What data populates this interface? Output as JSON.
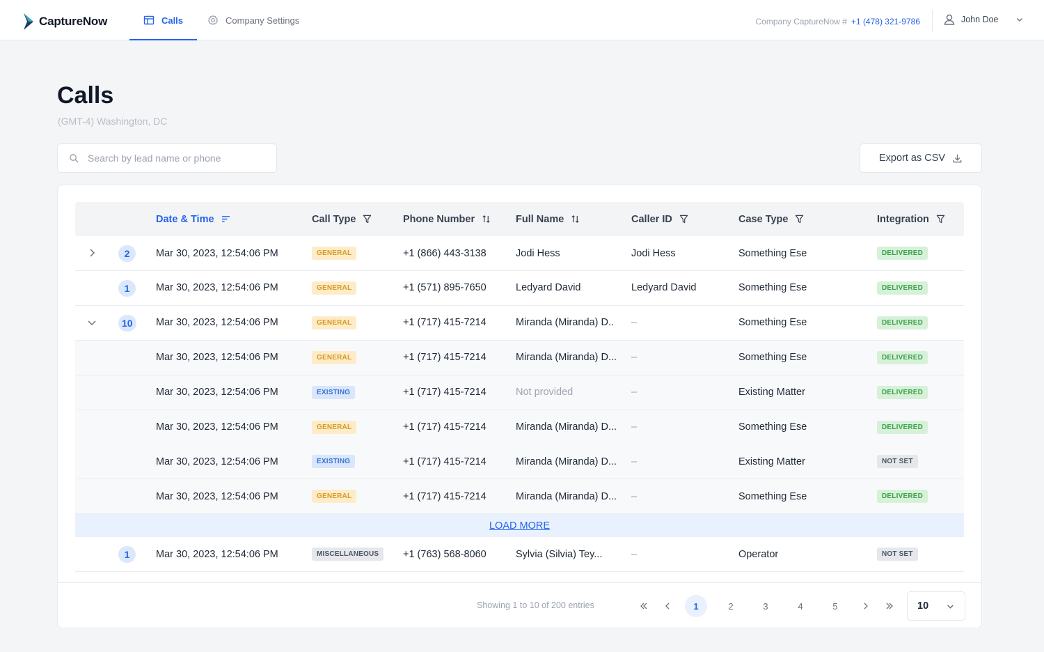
{
  "nav": {
    "brand": "CaptureNow",
    "tabs": [
      {
        "label": "Calls",
        "icon": "table-icon",
        "active": true
      },
      {
        "label": "Company Settings",
        "icon": "gear-icon",
        "active": false
      }
    ],
    "company_label": "Company CaptureNow #",
    "company_phone": "+1 (478) 321-9786",
    "user_name": "John Doe"
  },
  "header": {
    "title": "Calls",
    "timezone": "(GMT-4) Washington, DC",
    "search_placeholder": "Search by lead name or phone",
    "export_label": "Export as CSV"
  },
  "table": {
    "columns": [
      "Date & Time",
      "Call Type",
      "Phone Number",
      "Full Name",
      "Caller ID",
      "Case Type",
      "Integration"
    ],
    "rows": [
      {
        "expander": "collapsed",
        "count": "2",
        "datetime": "Mar 30, 2023, 12:54:06 PM",
        "call_type": "GENERAL",
        "phone": "+1 (866) 443-3138",
        "name": "Jodi Hess",
        "caller_id": "Jodi Hess",
        "case_type": "Something Ese",
        "integration": "DELIVERED"
      },
      {
        "expander": "none",
        "count": "1",
        "datetime": "Mar 30, 2023, 12:54:06 PM",
        "call_type": "GENERAL",
        "phone": "+1 (571) 895-7650",
        "name": "Ledyard David",
        "caller_id": "Ledyard David",
        "case_type": "Something Ese",
        "integration": "DELIVERED"
      },
      {
        "expander": "expanded",
        "count": "10",
        "datetime": "Mar 30, 2023, 12:54:06 PM",
        "call_type": "GENERAL",
        "phone": "+1 (717) 415-7214",
        "name": "Miranda (Miranda) D..",
        "caller_id": "–",
        "case_type": "Something Ese",
        "integration": "DELIVERED"
      },
      {
        "child": true,
        "datetime": "Mar 30, 2023, 12:54:06 PM",
        "call_type": "GENERAL",
        "phone": "+1 (717) 415-7214",
        "name": "Miranda (Miranda) D...",
        "caller_id": "–",
        "case_type": "Something Ese",
        "integration": "DELIVERED"
      },
      {
        "child": true,
        "datetime": "Mar 30, 2023, 12:54:06 PM",
        "call_type": "EXISTING",
        "phone": "+1 (717) 415-7214",
        "name": "Not provided",
        "name_muted": true,
        "caller_id": "–",
        "case_type": "Existing Matter",
        "integration": "DELIVERED"
      },
      {
        "child": true,
        "datetime": "Mar 30, 2023, 12:54:06 PM",
        "call_type": "GENERAL",
        "phone": "+1 (717) 415-7214",
        "name": "Miranda (Miranda) D...",
        "caller_id": "–",
        "case_type": "Something Ese",
        "integration": "DELIVERED"
      },
      {
        "child": true,
        "datetime": "Mar 30, 2023, 12:54:06 PM",
        "call_type": "EXISTING",
        "phone": "+1 (717) 415-7214",
        "name": "Miranda (Miranda) D...",
        "caller_id": "–",
        "case_type": "Existing Matter",
        "integration": "NOT SET"
      },
      {
        "child": true,
        "datetime": "Mar 30, 2023, 12:54:06 PM",
        "call_type": "GENERAL",
        "phone": "+1 (717) 415-7214",
        "name": "Miranda (Miranda) D...",
        "caller_id": "–",
        "case_type": "Something Ese",
        "integration": "DELIVERED"
      }
    ],
    "load_more_label": "LOAD MORE",
    "after_rows": [
      {
        "expander": "none",
        "count": "1",
        "datetime": "Mar 30, 2023, 12:54:06 PM",
        "call_type": "MISCELLANEOUS",
        "phone": "+1 (763) 568-8060",
        "name": "Sylvia (Silvia) Tey...",
        "caller_id": "–",
        "case_type": "Operator",
        "integration": "NOT SET"
      }
    ]
  },
  "pagination": {
    "showing": "Showing 1 to 10 of 200 entries",
    "pages": [
      "1",
      "2",
      "3",
      "4",
      "5"
    ],
    "current": "1",
    "page_size": "10"
  },
  "colors": {
    "accent": "#2563eb",
    "general": "#fdecc7",
    "existing": "#d9e6fb",
    "delivered": "#d7f1d9"
  }
}
